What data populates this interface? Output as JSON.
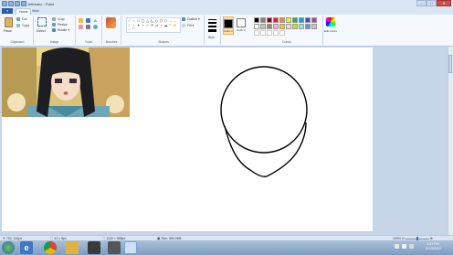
{
  "window": {
    "title": "Jetfreako - Paint",
    "controls": [
      "–",
      "□",
      "✕"
    ]
  },
  "ribbon": {
    "file_menu": "▾",
    "tabs": [
      "Home",
      "View"
    ],
    "clipboard": {
      "paste": "Paste",
      "cut": "Cut",
      "copy": "Copy",
      "label": "Clipboard"
    },
    "image": {
      "select": "Select",
      "crop": "Crop",
      "resize": "Resize",
      "rotate": "Rotate ▾",
      "label": "Image"
    },
    "tools": {
      "label": "Tools"
    },
    "brushes": {
      "label": "Brushes"
    },
    "shapes": {
      "outline": "Outline ▾",
      "fill": "Fill ▾",
      "label": "Shapes",
      "glyphs": [
        "⁄",
        "○",
        "□",
        "▢",
        "△",
        "◺",
        "◇",
        "⬠",
        "⬡",
        "→",
        "←",
        "↑",
        "↓",
        "✦",
        "✧",
        "☆",
        "✶",
        "▭",
        "◔",
        "☁",
        "♡",
        "⚡",
        "~",
        "⌒"
      ]
    },
    "size": {
      "label": "Size"
    },
    "color1": {
      "label": "Color 1"
    },
    "color2": {
      "label": "Color 2"
    },
    "colors": {
      "label": "Colors",
      "row1": [
        "#000000",
        "#7f7f7f",
        "#880015",
        "#ed1c24",
        "#ff7f27",
        "#fff200",
        "#22b14c",
        "#00a2e8",
        "#3f48cc",
        "#a349a4"
      ],
      "row2": [
        "#ffffff",
        "#c3c3c3",
        "#b97a57",
        "#ffaec9",
        "#ffc90e",
        "#efe4b0",
        "#b5e61d",
        "#99d9ea",
        "#7092be",
        "#c8bfe7"
      ]
    },
    "edit_colors": "Edit colors"
  },
  "status": {
    "cursor_pos": "732, 161px",
    "selection_size": "41 × 8px",
    "image_size": "1120 × 558px",
    "file_size": "Size: 895.0KB",
    "zoom": "100%"
  },
  "taskbar": {
    "time": "6:37 PM",
    "date": "11/13/2012"
  },
  "accent": "#2a5ca8"
}
